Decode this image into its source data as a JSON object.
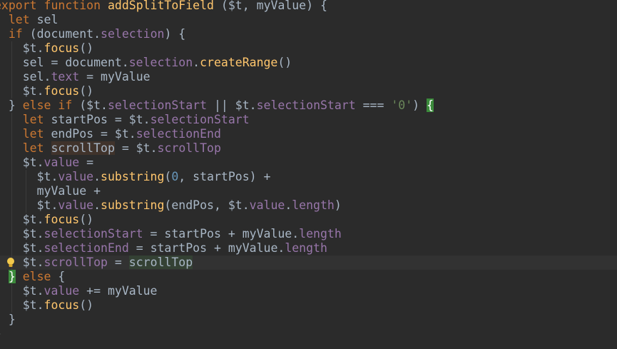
{
  "editor": {
    "lines": [
      [
        {
          "t": "export function ",
          "c": "kw"
        },
        {
          "t": "addSplitToField",
          "c": "fn"
        },
        {
          "t": " ($t, myValue) {",
          "c": "txt"
        }
      ],
      [
        {
          "t": "  ",
          "c": "txt"
        },
        {
          "t": "let",
          "c": "kw"
        },
        {
          "t": " sel",
          "c": "txt"
        }
      ],
      [
        {
          "t": "  ",
          "c": "txt"
        },
        {
          "t": "if",
          "c": "kw"
        },
        {
          "t": " (document.",
          "c": "txt"
        },
        {
          "t": "selection",
          "c": "prop"
        },
        {
          "t": ") {",
          "c": "txt"
        }
      ],
      [
        {
          "t": "    $t.",
          "c": "txt"
        },
        {
          "t": "focus",
          "c": "meth"
        },
        {
          "t": "()",
          "c": "txt"
        }
      ],
      [
        {
          "t": "    sel = document.",
          "c": "txt"
        },
        {
          "t": "selection",
          "c": "prop"
        },
        {
          "t": ".",
          "c": "txt"
        },
        {
          "t": "createRange",
          "c": "meth"
        },
        {
          "t": "()",
          "c": "txt"
        }
      ],
      [
        {
          "t": "    sel.",
          "c": "txt"
        },
        {
          "t": "text",
          "c": "prop"
        },
        {
          "t": " = myValue",
          "c": "txt"
        }
      ],
      [
        {
          "t": "    $t.",
          "c": "txt"
        },
        {
          "t": "focus",
          "c": "meth"
        },
        {
          "t": "()",
          "c": "txt"
        }
      ],
      [
        {
          "t": "  } ",
          "c": "txt"
        },
        {
          "t": "else if",
          "c": "kw"
        },
        {
          "t": " ($t.",
          "c": "txt"
        },
        {
          "t": "selectionStart",
          "c": "prop"
        },
        {
          "t": " || $t.",
          "c": "txt"
        },
        {
          "t": "selectionStart",
          "c": "prop"
        },
        {
          "t": " === ",
          "c": "txt"
        },
        {
          "t": "'0'",
          "c": "str"
        },
        {
          "t": ") ",
          "c": "txt"
        },
        {
          "t": "{",
          "c": "brace-green"
        }
      ],
      [
        {
          "t": "    ",
          "c": "txt"
        },
        {
          "t": "let",
          "c": "kw"
        },
        {
          "t": " startPos = $t.",
          "c": "txt"
        },
        {
          "t": "selectionStart",
          "c": "prop"
        }
      ],
      [
        {
          "t": "    ",
          "c": "txt"
        },
        {
          "t": "let",
          "c": "kw"
        },
        {
          "t": " endPos = $t.",
          "c": "txt"
        },
        {
          "t": "selectionEnd",
          "c": "prop"
        }
      ],
      [
        {
          "t": "    ",
          "c": "txt"
        },
        {
          "t": "let",
          "c": "kw"
        },
        {
          "t": " ",
          "c": "txt"
        },
        {
          "t": "scrollTop",
          "c": "var-hl2"
        },
        {
          "t": " = $t.",
          "c": "txt"
        },
        {
          "t": "scrollTop",
          "c": "prop"
        }
      ],
      [
        {
          "t": "    $t.",
          "c": "txt"
        },
        {
          "t": "value",
          "c": "prop"
        },
        {
          "t": " =",
          "c": "txt"
        }
      ],
      [
        {
          "t": "      $t.",
          "c": "txt"
        },
        {
          "t": "value",
          "c": "prop"
        },
        {
          "t": ".",
          "c": "txt"
        },
        {
          "t": "substring",
          "c": "meth"
        },
        {
          "t": "(",
          "c": "txt"
        },
        {
          "t": "0",
          "c": "num"
        },
        {
          "t": ", startPos) +",
          "c": "txt"
        }
      ],
      [
        {
          "t": "      myValue +",
          "c": "txt"
        }
      ],
      [
        {
          "t": "      $t.",
          "c": "txt"
        },
        {
          "t": "value",
          "c": "prop"
        },
        {
          "t": ".",
          "c": "txt"
        },
        {
          "t": "substring",
          "c": "meth"
        },
        {
          "t": "(endPos, $t.",
          "c": "txt"
        },
        {
          "t": "value",
          "c": "prop"
        },
        {
          "t": ".",
          "c": "txt"
        },
        {
          "t": "length",
          "c": "prop"
        },
        {
          "t": ")",
          "c": "txt"
        }
      ],
      [
        {
          "t": "    $t.",
          "c": "txt"
        },
        {
          "t": "focus",
          "c": "meth"
        },
        {
          "t": "()",
          "c": "txt"
        }
      ],
      [
        {
          "t": "    $t.",
          "c": "txt"
        },
        {
          "t": "selectionStart",
          "c": "prop"
        },
        {
          "t": " = startPos + myValue.",
          "c": "txt"
        },
        {
          "t": "length",
          "c": "prop"
        }
      ],
      [
        {
          "t": "    $t.",
          "c": "txt"
        },
        {
          "t": "selectionEnd",
          "c": "prop"
        },
        {
          "t": " = startPos + myValue.",
          "c": "txt"
        },
        {
          "t": "length",
          "c": "prop"
        }
      ],
      [
        {
          "t": "    $t.",
          "c": "txt"
        },
        {
          "t": "scrollTop",
          "c": "prop"
        },
        {
          "t": " = ",
          "c": "txt"
        },
        {
          "t": "scrollTop",
          "c": "var-hl"
        }
      ],
      [
        {
          "t": "  ",
          "c": "txt"
        },
        {
          "t": "}",
          "c": "brace-green"
        },
        {
          "t": " ",
          "c": "txt"
        },
        {
          "t": "else",
          "c": "kw"
        },
        {
          "t": " {",
          "c": "txt"
        }
      ],
      [
        {
          "t": "    $t.",
          "c": "txt"
        },
        {
          "t": "value",
          "c": "prop"
        },
        {
          "t": " += myValue",
          "c": "txt"
        }
      ],
      [
        {
          "t": "    $t.",
          "c": "txt"
        },
        {
          "t": "focus",
          "c": "meth"
        },
        {
          "t": "()",
          "c": "txt"
        }
      ],
      [
        {
          "t": "  }",
          "c": "txt"
        }
      ],
      [
        {
          "t": "}",
          "c": "txt"
        }
      ]
    ],
    "current_line": 18,
    "intention_bulb_line": 18,
    "intention_bulb_icon": "lightbulb-icon",
    "colors": {
      "background": "#2b2b2b",
      "keyword": "#cc7832",
      "function": "#ffc66d",
      "property": "#9876aa",
      "string": "#6a8759",
      "number": "#6897bb",
      "text": "#a9b7c6"
    }
  }
}
